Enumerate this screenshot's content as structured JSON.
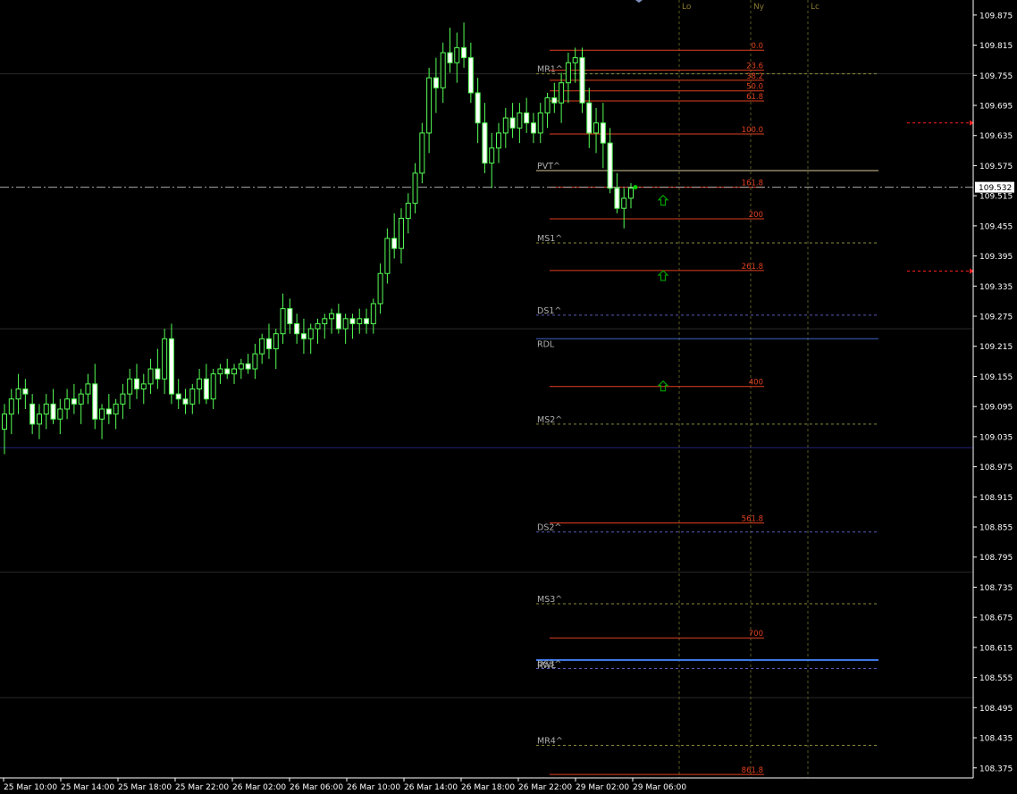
{
  "chart_data": {
    "type": "candlestick",
    "title": "",
    "y_axis": {
      "min": 108.355,
      "max": 109.905,
      "tick_labels": [
        "109.875",
        "109.815",
        "109.755",
        "109.695",
        "109.635",
        "109.575",
        "109.515",
        "109.455",
        "109.395",
        "109.335",
        "109.275",
        "109.215",
        "109.155",
        "109.095",
        "109.035",
        "108.975",
        "108.915",
        "108.855",
        "108.795",
        "108.735",
        "108.675",
        "108.615",
        "108.555",
        "108.495",
        "108.435",
        "108.375"
      ],
      "current_price": "109.532"
    },
    "x_axis": {
      "tick_labels": [
        "25 Mar 10:00",
        "25 Mar 14:00",
        "25 Mar 18:00",
        "25 Mar 22:00",
        "26 Mar 02:00",
        "26 Mar 06:00",
        "26 Mar 10:00",
        "26 Mar 14:00",
        "26 Mar 18:00",
        "26 Mar 22:00",
        "29 Mar 02:00",
        "29 Mar 06:00"
      ]
    },
    "session_labels": [
      "Lo",
      "Ny",
      "Lc"
    ],
    "candles": [
      [
        109.05,
        109.1,
        109.0,
        109.08
      ],
      [
        109.08,
        109.13,
        109.04,
        109.11
      ],
      [
        109.11,
        109.16,
        109.08,
        109.13
      ],
      [
        109.13,
        109.15,
        109.09,
        109.12
      ],
      [
        109.1,
        109.12,
        109.04,
        109.06
      ],
      [
        109.06,
        109.1,
        109.03,
        109.08
      ],
      [
        109.08,
        109.12,
        109.05,
        109.1
      ],
      [
        109.1,
        109.13,
        109.06,
        109.07
      ],
      [
        109.07,
        109.11,
        109.04,
        109.09
      ],
      [
        109.09,
        109.13,
        109.07,
        109.11
      ],
      [
        109.11,
        109.14,
        109.08,
        109.1
      ],
      [
        109.1,
        109.13,
        109.06,
        109.12
      ],
      [
        109.12,
        109.16,
        109.1,
        109.14
      ],
      [
        109.14,
        109.18,
        109.05,
        109.07
      ],
      [
        109.07,
        109.1,
        109.03,
        109.09
      ],
      [
        109.09,
        109.12,
        109.06,
        109.08
      ],
      [
        109.08,
        109.11,
        109.05,
        109.1
      ],
      [
        109.1,
        109.14,
        109.07,
        109.12
      ],
      [
        109.12,
        109.17,
        109.09,
        109.15
      ],
      [
        109.15,
        109.18,
        109.11,
        109.13
      ],
      [
        109.13,
        109.16,
        109.1,
        109.14
      ],
      [
        109.14,
        109.19,
        109.12,
        109.17
      ],
      [
        109.17,
        109.21,
        109.13,
        109.15
      ],
      [
        109.15,
        109.25,
        109.12,
        109.23
      ],
      [
        109.23,
        109.26,
        109.1,
        109.12
      ],
      [
        109.12,
        109.15,
        109.09,
        109.11
      ],
      [
        109.11,
        109.13,
        109.08,
        109.1
      ],
      [
        109.1,
        109.14,
        109.08,
        109.13
      ],
      [
        109.13,
        109.17,
        109.1,
        109.15
      ],
      [
        109.15,
        109.18,
        109.1,
        109.11
      ],
      [
        109.11,
        109.17,
        109.09,
        109.16
      ],
      [
        109.16,
        109.18,
        109.14,
        109.17
      ],
      [
        109.17,
        109.19,
        109.15,
        109.16
      ],
      [
        109.16,
        109.18,
        109.14,
        109.17
      ],
      [
        109.17,
        109.19,
        109.15,
        109.18
      ],
      [
        109.18,
        109.2,
        109.16,
        109.17
      ],
      [
        109.17,
        109.22,
        109.15,
        109.2
      ],
      [
        109.2,
        109.24,
        109.18,
        109.23
      ],
      [
        109.23,
        109.26,
        109.19,
        109.21
      ],
      [
        109.21,
        109.25,
        109.17,
        109.24
      ],
      [
        109.24,
        109.32,
        109.22,
        109.29
      ],
      [
        109.29,
        109.31,
        109.24,
        109.26
      ],
      [
        109.26,
        109.28,
        109.22,
        109.24
      ],
      [
        109.24,
        109.27,
        109.2,
        109.23
      ],
      [
        109.23,
        109.26,
        109.2,
        109.25
      ],
      [
        109.25,
        109.27,
        109.22,
        109.26
      ],
      [
        109.26,
        109.28,
        109.23,
        109.27
      ],
      [
        109.27,
        109.29,
        109.24,
        109.28
      ],
      [
        109.28,
        109.3,
        109.24,
        109.25
      ],
      [
        109.25,
        109.28,
        109.22,
        109.27
      ],
      [
        109.27,
        109.28,
        109.23,
        109.26
      ],
      [
        109.26,
        109.29,
        109.24,
        109.27
      ],
      [
        109.27,
        109.29,
        109.24,
        109.26
      ],
      [
        109.26,
        109.31,
        109.24,
        109.3
      ],
      [
        109.3,
        109.38,
        109.28,
        109.36
      ],
      [
        109.36,
        109.45,
        109.34,
        109.43
      ],
      [
        109.43,
        109.48,
        109.39,
        109.41
      ],
      [
        109.41,
        109.49,
        109.38,
        109.47
      ],
      [
        109.47,
        109.52,
        109.44,
        109.5
      ],
      [
        109.5,
        109.58,
        109.48,
        109.56
      ],
      [
        109.56,
        109.66,
        109.54,
        109.64
      ],
      [
        109.64,
        109.77,
        109.6,
        109.75
      ],
      [
        109.75,
        109.79,
        109.68,
        109.73
      ],
      [
        109.73,
        109.82,
        109.7,
        109.8
      ],
      [
        109.8,
        109.85,
        109.76,
        109.78
      ],
      [
        109.78,
        109.84,
        109.74,
        109.81
      ],
      [
        109.81,
        109.86,
        109.77,
        109.79
      ],
      [
        109.79,
        109.82,
        109.7,
        109.72
      ],
      [
        109.72,
        109.75,
        109.62,
        109.66
      ],
      [
        109.66,
        109.7,
        109.56,
        109.58
      ],
      [
        109.58,
        109.64,
        109.53,
        109.61
      ],
      [
        109.61,
        109.66,
        109.58,
        109.64
      ],
      [
        109.64,
        109.69,
        109.61,
        109.67
      ],
      [
        109.67,
        109.7,
        109.63,
        109.65
      ],
      [
        109.65,
        109.7,
        109.62,
        109.68
      ],
      [
        109.68,
        109.71,
        109.64,
        109.66
      ],
      [
        109.66,
        109.68,
        109.62,
        109.64
      ],
      [
        109.64,
        109.7,
        109.62,
        109.68
      ],
      [
        109.68,
        109.72,
        109.65,
        109.71
      ],
      [
        109.71,
        109.74,
        109.68,
        109.7
      ],
      [
        109.7,
        109.76,
        109.66,
        109.74
      ],
      [
        109.74,
        109.8,
        109.7,
        109.78
      ],
      [
        109.78,
        109.81,
        109.74,
        109.79
      ],
      [
        109.79,
        109.81,
        109.68,
        109.7
      ],
      [
        109.7,
        109.73,
        109.61,
        109.64
      ],
      [
        109.64,
        109.69,
        109.6,
        109.66
      ],
      [
        109.66,
        109.7,
        109.57,
        109.62
      ],
      [
        109.62,
        109.65,
        109.52,
        109.53
      ],
      [
        109.53,
        109.56,
        109.48,
        109.49
      ],
      [
        109.49,
        109.53,
        109.45,
        109.51
      ],
      [
        109.51,
        109.54,
        109.49,
        109.53
      ]
    ],
    "horizontal_levels": [
      {
        "label": "MR1^",
        "price": 109.758,
        "color": "#8a8a3a",
        "style": "dashed"
      },
      {
        "label": "PVT^",
        "price": 109.565,
        "color": "#d8c898",
        "style": "solid"
      },
      {
        "label": "MS1^",
        "price": 109.421,
        "color": "#8a8a3a",
        "style": "dashed"
      },
      {
        "label": "DS1^",
        "price": 109.277,
        "color": "#5a5ab8",
        "style": "dashed"
      },
      {
        "label": "RDL",
        "price": 109.23,
        "color": "#3c64c8",
        "style": "solid"
      },
      {
        "label": "MS2^",
        "price": 109.06,
        "color": "#8a8a3a",
        "style": "dashed"
      },
      {
        "label": "DS2^",
        "price": 108.845,
        "color": "#5a5ab8",
        "style": "dashed"
      },
      {
        "label": "MS3^",
        "price": 108.702,
        "color": "#8a8a3a",
        "style": "dashed"
      },
      {
        "label": "RWL",
        "price": 108.59,
        "color": "#3c78e6",
        "style": "solid"
      },
      {
        "label": "DS3^",
        "price": 108.573,
        "color": "#5a5ab8",
        "style": "dashed"
      },
      {
        "label": "MR4^",
        "price": 108.42,
        "color": "#8a8a3a",
        "style": "dashed"
      }
    ],
    "fib_levels": [
      {
        "label": "0.0",
        "price": 109.805
      },
      {
        "label": "23.6",
        "price": 109.765
      },
      {
        "label": "38.2",
        "price": 109.745
      },
      {
        "label": "50.0",
        "price": 109.724
      },
      {
        "label": "61.8",
        "price": 109.704
      },
      {
        "label": "100.0",
        "price": 109.638
      },
      {
        "label": "161.8",
        "price": 109.532
      },
      {
        "label": "200",
        "price": 109.469
      },
      {
        "label": "261.8",
        "price": 109.366
      },
      {
        "label": "400",
        "price": 109.135
      },
      {
        "label": "561.8",
        "price": 108.863
      },
      {
        "label": "700",
        "price": 108.634
      },
      {
        "label": "861.8",
        "price": 108.362
      }
    ],
    "grid_lines": [
      109.758,
      109.25,
      109.013,
      108.765,
      108.515
    ],
    "buy_arrows": [
      109.505,
      109.355,
      109.135
    ],
    "colors": {
      "background": "#000000",
      "bull": "#ffffff",
      "bear": "#ffffff",
      "wick": "#55ff55",
      "fib": "#e04020",
      "axis": "#ffffff",
      "grid": "#2a2a2a",
      "session": "#5a5a20",
      "price_line": "#aaaaaa",
      "arrow": "#00a000",
      "target": "#ff2020"
    }
  }
}
